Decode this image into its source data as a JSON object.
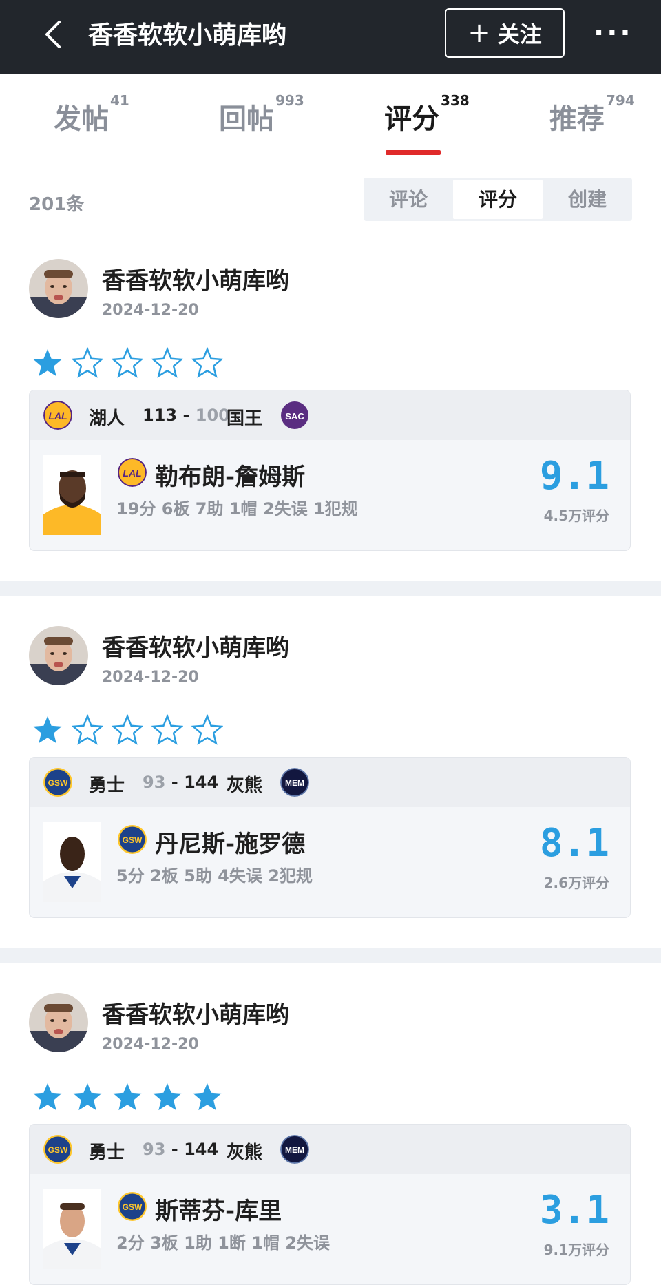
{
  "header": {
    "title": "香香软软小萌库哟",
    "follow_label": "关注",
    "more_label": "···"
  },
  "tabs": [
    {
      "label": "发帖",
      "count": "41"
    },
    {
      "label": "回帖",
      "count": "993"
    },
    {
      "label": "评分",
      "count": "338"
    },
    {
      "label": "推荐",
      "count": "794"
    }
  ],
  "list": {
    "total": "201条",
    "filters": [
      "评论",
      "评分",
      "创建"
    ],
    "selected_filter": "评分"
  },
  "colors": {
    "accent": "#2b9ee0",
    "tab_indicator": "#e02a2a",
    "header_bg": "#22262c",
    "lakers": "#552583",
    "kings": "#5a2d81",
    "warriors": "#1d428a",
    "grizzlies": "#12173f"
  },
  "posts": [
    {
      "user": "香香软软小萌库哟",
      "date": "2024-12-20",
      "stars": 1,
      "home_team": "湖人",
      "home_logo": "LAL",
      "home_score": "113",
      "away_team": "国王",
      "away_logo": "SAC",
      "away_score": "100",
      "player_name": "勒布朗-詹姆斯",
      "player_team_logo": "LAL",
      "player_stats": "19分  6板  7助  1帽  2失误  1犯规",
      "rating": "9.1",
      "rating_count": "4.5万评分"
    },
    {
      "user": "香香软软小萌库哟",
      "date": "2024-12-20",
      "stars": 1,
      "home_team": "勇士",
      "home_logo": "GSW",
      "home_score": "93",
      "away_team": "灰熊",
      "away_logo": "MEM",
      "away_score": "144",
      "player_name": "丹尼斯-施罗德",
      "player_team_logo": "GSW",
      "player_stats": "5分  2板  5助  4失误  2犯规",
      "rating": "8.1",
      "rating_count": "2.6万评分"
    },
    {
      "user": "香香软软小萌库哟",
      "date": "2024-12-20",
      "stars": 5,
      "home_team": "勇士",
      "home_logo": "GSW",
      "home_score": "93",
      "away_team": "灰熊",
      "away_logo": "MEM",
      "away_score": "144",
      "player_name": "斯蒂芬-库里",
      "player_team_logo": "GSW",
      "player_stats": "2分  3板  1助  1断  1帽  2失误",
      "rating": "3.1",
      "rating_count": "9.1万评分"
    }
  ]
}
